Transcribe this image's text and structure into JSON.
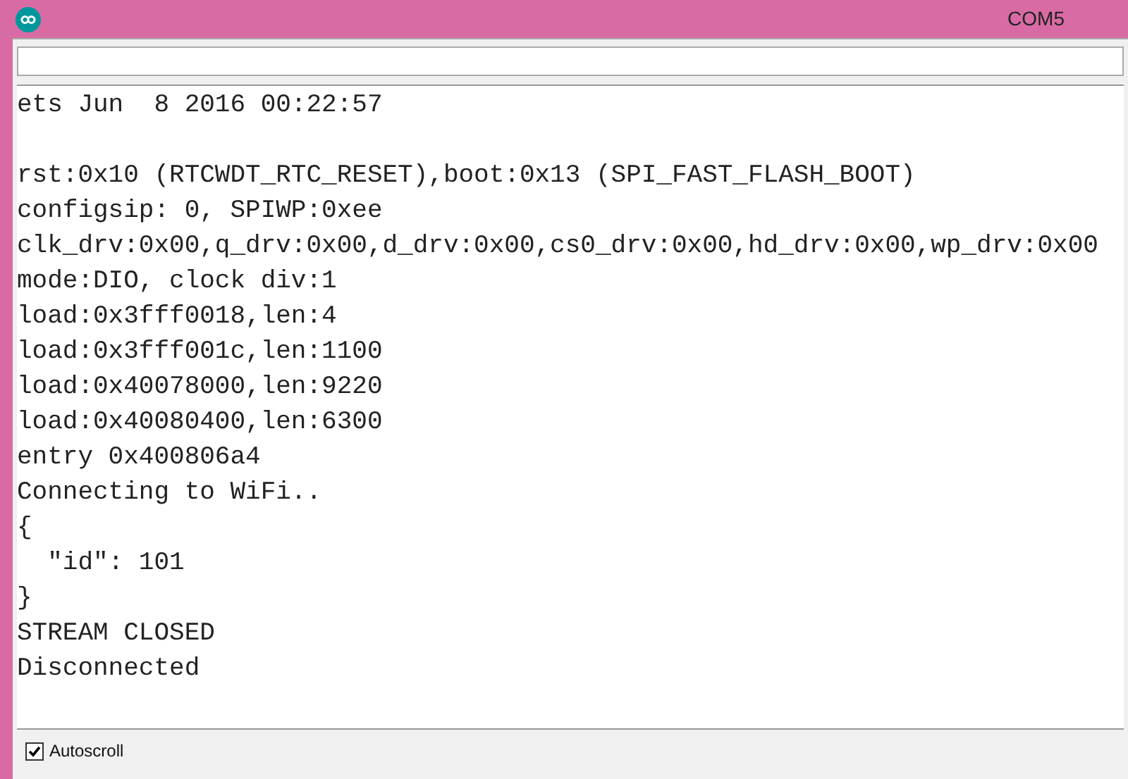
{
  "window": {
    "title": "COM5"
  },
  "output": {
    "lines": [
      {
        "text": "ets Jun  8 2016 00:22:57",
        "blank_before": false
      },
      {
        "text": "rst:0x10 (RTCWDT_RTC_RESET),boot:0x13 (SPI_FAST_FLASH_BOOT)",
        "blank_before": true
      },
      {
        "text": "configsip: 0, SPIWP:0xee",
        "blank_before": false
      },
      {
        "text": "clk_drv:0x00,q_drv:0x00,d_drv:0x00,cs0_drv:0x00,hd_drv:0x00,wp_drv:0x00",
        "blank_before": false
      },
      {
        "text": "mode:DIO, clock div:1",
        "blank_before": false
      },
      {
        "text": "load:0x3fff0018,len:4",
        "blank_before": false
      },
      {
        "text": "load:0x3fff001c,len:1100",
        "blank_before": false
      },
      {
        "text": "load:0x40078000,len:9220",
        "blank_before": false
      },
      {
        "text": "load:0x40080400,len:6300",
        "blank_before": false
      },
      {
        "text": "entry 0x400806a4",
        "blank_before": false
      },
      {
        "text": "Connecting to WiFi..",
        "blank_before": false
      },
      {
        "text": "{",
        "blank_before": false
      },
      {
        "text": "  \"id\": 101",
        "blank_before": false
      },
      {
        "text": "}",
        "blank_before": false
      },
      {
        "text": "STREAM CLOSED",
        "blank_before": false
      },
      {
        "text": "Disconnected",
        "blank_before": false
      }
    ]
  },
  "autoscroll": {
    "label": "Autoscroll",
    "checked": true
  }
}
